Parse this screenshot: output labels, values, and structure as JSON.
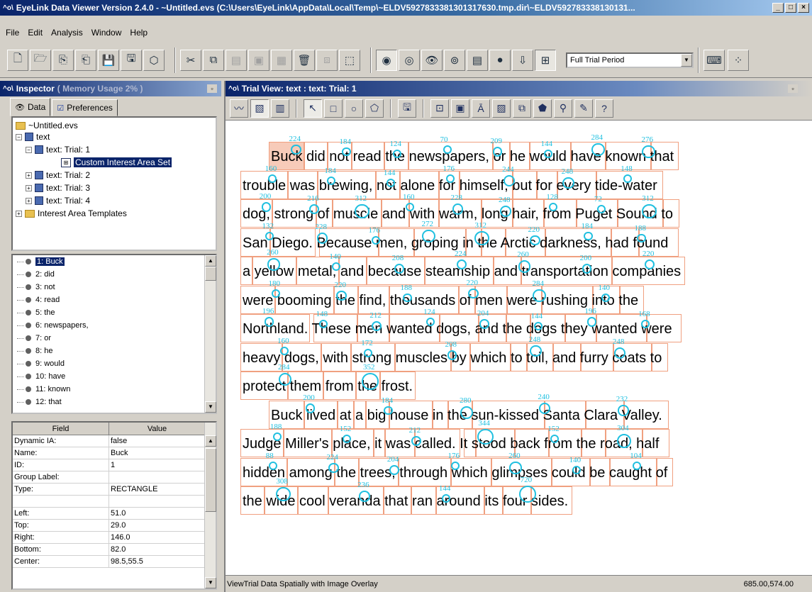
{
  "window": {
    "title": "EyeLink Data Viewer Version 2.4.0 - ~Untitled.evs (C:\\Users\\EyeLink\\AppData\\Local\\Temp\\~ELDV5927833381301317630.tmp.dir\\~ELDV592783338130131...",
    "min": "_",
    "max": "□",
    "close": "×"
  },
  "menu": [
    "File",
    "Edit",
    "Analysis",
    "Window",
    "Help"
  ],
  "toolbar": {
    "period_value": "Full Trial Period"
  },
  "inspector": {
    "title": "Inspector",
    "memory": "( Memory Usage 2% )",
    "tabs": [
      "Data",
      "Preferences"
    ],
    "tree": {
      "root": "~Untitled.evs",
      "text": "text",
      "trial1": "text: Trial: 1",
      "ia_set": "Custom Interest Area Set",
      "trial2": "text: Trial: 2",
      "trial3": "text: Trial: 3",
      "trial4": "text: Trial: 4",
      "templates": "Interest Area Templates"
    },
    "ia_list": [
      "1: Buck",
      "2: did",
      "3: not",
      "4: read",
      "5: the",
      "6: newspapers,",
      "7: or",
      "8: he",
      "9: would",
      "10: have",
      "11: known",
      "12: that"
    ],
    "props": {
      "head_field": "Field",
      "head_value": "Value",
      "rows": [
        {
          "f": "Dynamic IA:",
          "v": "false"
        },
        {
          "f": "Name:",
          "v": "Buck"
        },
        {
          "f": "ID:",
          "v": "1"
        },
        {
          "f": "Group Label:",
          "v": ""
        },
        {
          "f": "Type:",
          "v": "RECTANGLE"
        },
        {
          "f": "",
          "v": ""
        },
        {
          "f": "Left:",
          "v": "51.0"
        },
        {
          "f": "Top:",
          "v": "29.0"
        },
        {
          "f": "Right:",
          "v": "146.0"
        },
        {
          "f": "Bottom:",
          "v": "82.0"
        },
        {
          "f": "Center:",
          "v": "98.5,55.5"
        }
      ]
    }
  },
  "trial_view": {
    "title": "Trial View: text : text: Trial: 1",
    "lines": [
      "Buck did not read the newspapers, or he would have known that",
      "trouble was brewing, not alone for himself, but for every tide-water",
      "dog, strong of muscle and with warm, long hair, from Puget Sound to",
      "San Diego.  Because men, groping in the Arctic darkness, had found",
      "a yellow metal, and because steamship and transportation companies",
      "were booming the find, thousands of men were rushing into the",
      "Northland.  These men wanted dogs, and the dogs they wanted were",
      "heavy dogs, with strong muscles by which to toil, and furry coats to",
      "protect them from the frost.",
      "Buck lived at a big house in the sun-kissed Santa Clara Valley.",
      "Judge Miller's place, it was called.  It stood back from the road, half",
      "hidden among the trees, through which glimpses could be caught of",
      "the wide cool veranda that ran around its four sides."
    ],
    "fixation_durations": [
      "224",
      "184",
      "124",
      "70",
      "209",
      "144",
      "284",
      "276",
      "160",
      "184",
      "144",
      "176",
      "244",
      "248",
      "148",
      "200",
      "216",
      "312",
      "160",
      "228",
      "248",
      "128",
      "72",
      "312",
      "132",
      "228",
      "176",
      "272",
      "312",
      "220",
      "184",
      "188",
      "260",
      "140",
      "208",
      "224",
      "260",
      "200",
      "220",
      "180",
      "220",
      "188",
      "220",
      "284",
      "140",
      "196",
      "148",
      "212",
      "124",
      "204",
      "144",
      "196",
      "168",
      "160",
      "172",
      "208",
      "248",
      "248",
      "284",
      "352",
      "200",
      "184",
      "280",
      "240",
      "232",
      "188",
      "152",
      "212",
      "344",
      "152",
      "304",
      "88",
      "224",
      "204",
      "176",
      "260",
      "140",
      "104",
      "308",
      "236",
      "144",
      "720"
    ],
    "status_text": "ViewTrial Data Spatially with Image Overlay",
    "coordinates": "685.00,574.00"
  }
}
